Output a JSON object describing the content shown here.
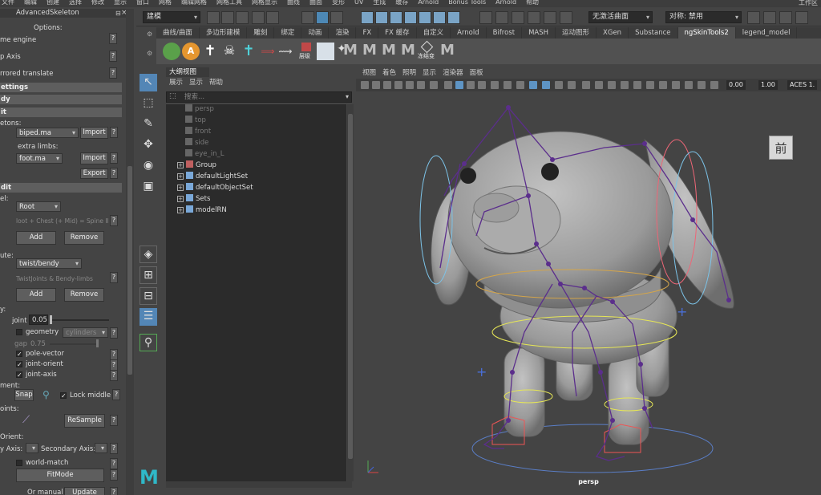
{
  "menubar": {
    "items": [
      "文件",
      "编辑",
      "创建",
      "选择",
      "修改",
      "显示",
      "窗口",
      "网格",
      "编辑网格",
      "网格工具",
      "网格显示",
      "曲线",
      "曲面",
      "变形",
      "UV",
      "生成",
      "缓存",
      "Arnold",
      "Bonus Tools",
      "Arnold",
      "帮助"
    ],
    "workspace": "工作区"
  },
  "statusline": {
    "mode": "建模",
    "live_surface": "无激活曲面",
    "symmetry": "对称: 禁用"
  },
  "shelf": {
    "tabs": [
      "曲线/曲面",
      "多边形建模",
      "雕刻",
      "绑定",
      "动画",
      "渲染",
      "FX",
      "FX 缓存",
      "自定义",
      "Arnold",
      "Bifrost",
      "MASH",
      "运动图形",
      "XGen",
      "Substance",
      "ngSkinTools2",
      "legend_model"
    ],
    "active_tab": "ngSkinTools2",
    "icon_labels": {
      "layers": "层级",
      "freeze": "冻结变"
    }
  },
  "left_panel": {
    "title": "AdvancedSkeleton",
    "options_label": "Options:",
    "rows": {
      "game_engine": "me engine",
      "up_axis": "p Axis",
      "mirrored_translate": "rrored translate",
      "settings": "ettings",
      "body": "dy",
      "fit": "it",
      "skeletons_label": "etons:",
      "skeleton_file": "biped.ma",
      "import1": "Import",
      "extra_limbs_label": "extra limbs:",
      "limb_file": "foot.ma",
      "import2": "Import",
      "export": "Export",
      "edit": "dit",
      "level_label": "el:",
      "level_value": "Root",
      "hint_line": "loot + Chest (+ Mid) = Spine II",
      "add1": "Add",
      "remove1": "Remove",
      "attribute_label": "ute:",
      "attribute_value": "twist/bendy",
      "twist_hint": "TwistJoints & Bendy-limbs",
      "add2": "Add",
      "remove2": "Remove",
      "display_label": "y:",
      "joint_label": "joint",
      "joint_value": "0.05",
      "geometry_label": "geometry",
      "geometry_value": "cylinders",
      "gap_label": "gap",
      "gap_value": "0.75",
      "pole_vector": "pole-vector",
      "joint_orient": "joint-orient",
      "joint_axis": "joint-axis",
      "alignment_label": "ment:",
      "snap_label": "Snap",
      "lock_middle": "Lock middle",
      "joints_label": "oints:",
      "resample": "ReSample",
      "orient_label": "Orient:",
      "primary_axis": "y Axis:",
      "secondary_axis": "Secondary Axis:",
      "world_match": "world-match",
      "fitmode": "FitMode",
      "or_manual": "Or manual",
      "update_now": "Update Now",
      "q": "?"
    }
  },
  "outliner": {
    "tab": "大纲视图",
    "menus": [
      "展示",
      "显示",
      "帮助"
    ],
    "search_placeholder": "搜索...",
    "items": [
      {
        "label": "persp",
        "dim": true
      },
      {
        "label": "top",
        "dim": true
      },
      {
        "label": "front",
        "dim": true
      },
      {
        "label": "side",
        "dim": true
      },
      {
        "label": "eye_in_L",
        "dim": true
      },
      {
        "label": "Group",
        "dim": false
      },
      {
        "label": "defaultLightSet",
        "dim": false
      },
      {
        "label": "defaultObjectSet",
        "dim": false
      },
      {
        "label": "Sets",
        "dim": false
      },
      {
        "label": "modelRN",
        "dim": false
      }
    ]
  },
  "viewport": {
    "menus": [
      "视图",
      "着色",
      "照明",
      "显示",
      "渲染器",
      "面板"
    ],
    "exposure": "0.00",
    "gamma": "1.00",
    "color_space": "ACES 1.",
    "camera_label": "persp",
    "viewcube_label": "前"
  },
  "colors": {
    "accent": "#5386b6",
    "joint": "#5b2e8c",
    "character": "#a6a6a6"
  }
}
